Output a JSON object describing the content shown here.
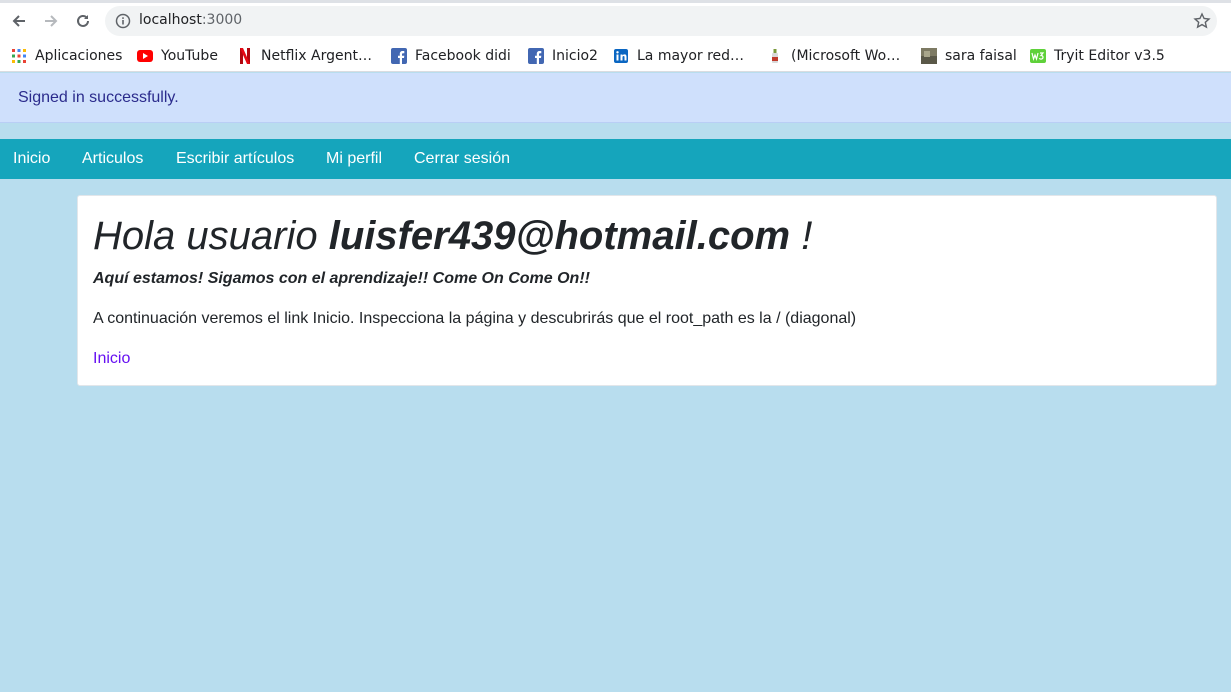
{
  "browser": {
    "url_host": "localhost",
    "url_port": ":3000",
    "bookmarks": [
      {
        "label": "Aplicaciones",
        "icon": "apps-grid-icon"
      },
      {
        "label": "YouTube",
        "icon": "youtube-icon"
      },
      {
        "label": "Netflix Argent…",
        "icon": "netflix-icon"
      },
      {
        "label": "Facebook didi",
        "icon": "facebook-icon"
      },
      {
        "label": "Inicio2",
        "icon": "facebook-icon"
      },
      {
        "label": "La mayor red…",
        "icon": "linkedin-icon"
      },
      {
        "label": "(Microsoft Wo…",
        "icon": "bottle-icon"
      },
      {
        "label": "sara faisal",
        "icon": "image-thumbnail-icon"
      },
      {
        "label": "Tryit Editor v3.5",
        "icon": "w3schools-icon"
      }
    ]
  },
  "alert": {
    "message": "Signed in successfully."
  },
  "navbar": {
    "items": [
      {
        "label": "Inicio"
      },
      {
        "label": "Articulos"
      },
      {
        "label": "Escribir artículos"
      },
      {
        "label": "Mi perfil"
      },
      {
        "label": "Cerrar sesión"
      }
    ]
  },
  "main": {
    "greeting_prefix": "Hola usuario",
    "username": "luisfer439@hotmail.com",
    "greeting_suffix": " !",
    "subtitle": "Aquí estamos! Sigamos con el aprendizaje!! Come On Come On!!",
    "paragraph": "A continuación veremos el link Inicio. Inspecciona la página y descubrirás que el root_path es la / (diagonal)",
    "link_label": "Inicio"
  },
  "colors": {
    "page_bg": "#b8ddee",
    "navbar_bg": "#15a5bc",
    "alert_bg": "#cfe0fc",
    "alert_text": "#2b2b8c",
    "link": "#6610f2"
  }
}
